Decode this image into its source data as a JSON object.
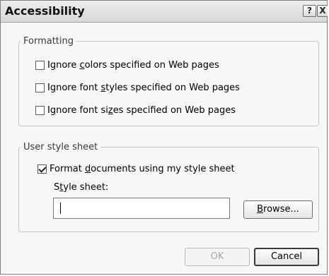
{
  "window": {
    "title": "Accessibility",
    "help_glyph": "?",
    "close_glyph": "X"
  },
  "formatting": {
    "legend": "Formatting",
    "options": [
      {
        "pre": "Ignore ",
        "ul": "c",
        "post": "olors specified on Web pages",
        "checked": false
      },
      {
        "pre": "Ignore font ",
        "ul": "s",
        "post": "tyles specified on Web pages",
        "checked": false
      },
      {
        "pre": "Ignore font si",
        "ul": "z",
        "post": "es specified on Web pages",
        "checked": false
      }
    ]
  },
  "user_style": {
    "legend": "User style sheet",
    "format_option": {
      "pre": "Format ",
      "ul": "d",
      "post": "ocuments using my style sheet",
      "checked": true
    },
    "style_sheet_label": {
      "pre": "S",
      "ul": "t",
      "post": "yle sheet:"
    },
    "style_sheet_value": "",
    "browse_label": {
      "ul": "B",
      "post": "rowse..."
    }
  },
  "buttons": {
    "ok": "OK",
    "cancel": "Cancel"
  }
}
